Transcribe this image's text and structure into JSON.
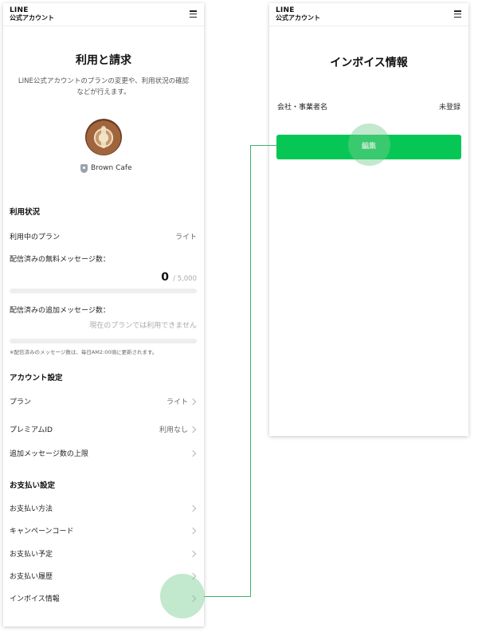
{
  "left": {
    "logo": {
      "line1": "LINE",
      "line2": "公式アカウント"
    },
    "page_title": "利用と請求",
    "description": "LINE公式アカウントのプランの変更や、利用状況の確認などが行えます。",
    "account_name": "Brown Cafe",
    "usage": {
      "section_title": "利用状況",
      "plan_label": "利用中のプラン",
      "plan_value": "ライト",
      "free_messages_label": "配信済みの無料メッセージ数：",
      "free_messages_count": "0",
      "free_messages_limit": "/ 5,000",
      "free_messages_ratio": 0,
      "extra_messages_label": "配信済みの追加メッセージ数：",
      "extra_messages_value": "現在のプランでは利用できません",
      "note": "※配信済みのメッセージ数は、毎日AM2:00頃に更新されます。"
    },
    "account_settings": {
      "section_title": "アカウント設定",
      "plan_label": "プラン",
      "plan_value": "ライト",
      "premium_id_label": "プレミアムID",
      "premium_id_value": "利用なし",
      "extra_limit_label": "追加メッセージ数の上限"
    },
    "payment_settings": {
      "section_title": "お支払い設定",
      "items": [
        "お支払い方法",
        "キャンペーンコード",
        "お支払い予定",
        "お支払い履歴",
        "インボイス情報"
      ]
    }
  },
  "right": {
    "logo": {
      "line1": "LINE",
      "line2": "公式アカウント"
    },
    "page_title": "インボイス情報",
    "company_label": "会社・事業者名",
    "company_value": "未登録",
    "edit_button": "編集"
  },
  "colors": {
    "accent": "#06c755",
    "tap_highlight": "#8fd9a8",
    "connector": "#3fb06b"
  }
}
